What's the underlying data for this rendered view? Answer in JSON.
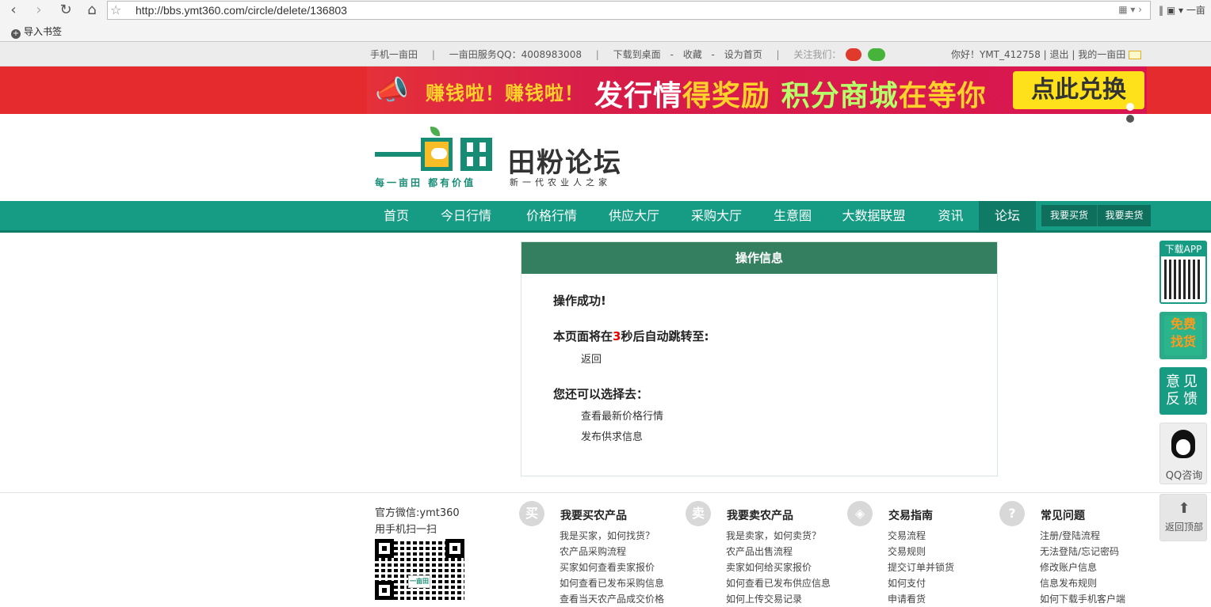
{
  "browser": {
    "back": "‹",
    "forward": "›",
    "reload": "↻",
    "home": "⌂",
    "url": "http://bbs.ymt360.com/circle/delete/136803",
    "bookmark_label": "导入书签",
    "right_fragment": "一亩"
  },
  "topbar": {
    "mobile": "手机一亩田",
    "qq": "一亩田服务QQ：4008983008",
    "download": "下载到桌面",
    "favorite": "收藏",
    "homepage": "设为首页",
    "follow": "关注我们：",
    "greeting": "你好！YMT_412758",
    "logout": "退出",
    "my": "我的一亩田"
  },
  "banner": {
    "earn": "赚钱啦！赚钱啦！",
    "slogan_white1": "发行情",
    "slogan_yellow": "得奖励",
    "slogan_green": "积分商城",
    "slogan_white2": "在等你",
    "cta": "点此兑换"
  },
  "logo": {
    "slogan1": "每一亩田 都有价值",
    "title": "田粉论坛",
    "slogan2": "新一代农业人之家"
  },
  "nav": {
    "items": [
      {
        "label": "首页"
      },
      {
        "label": "今日行情"
      },
      {
        "label": "价格行情"
      },
      {
        "label": "供应大厅"
      },
      {
        "label": "采购大厅"
      },
      {
        "label": "生意圈"
      },
      {
        "label": "大数据联盟"
      },
      {
        "label": "资讯"
      },
      {
        "label": "论坛"
      }
    ],
    "buy": "我要买货",
    "sell": "我要卖货"
  },
  "message": {
    "title": "操作信息",
    "success": "操作成功!",
    "redirect_prefix": "本页面将在",
    "countdown": "3",
    "redirect_suffix": "秒后自动跳转至:",
    "back": "返回",
    "choose": "您还可以选择去：",
    "link1": "查看最新价格行情",
    "link2": "发布供求信息"
  },
  "sidebar": {
    "download_app": "下载APP",
    "free_find_1": "免费",
    "free_find_2": "找货",
    "feedback_1": "意见",
    "feedback_2": "反馈",
    "qq": "QQ咨询",
    "back_top": "返回顶部"
  },
  "footer": {
    "wechat": "官方微信:ymt360",
    "scan": "用手机扫一扫",
    "qr_mark": "一亩田",
    "columns": [
      {
        "icon": "买",
        "title": "我要买农产品",
        "links": [
          "我是买家，如何找货？",
          "农产品采购流程",
          "买家如何查看卖家报价",
          "如何查看已发布采购信息",
          "查看当天农产品成交价格"
        ]
      },
      {
        "icon": "卖",
        "title": "我要卖农产品",
        "links": [
          "我是卖家，如何卖货？",
          "农产品出售流程",
          "卖家如何给买家报价",
          "如何查看已发布供应信息",
          "如何上传交易记录"
        ]
      },
      {
        "icon": "◈",
        "title": "交易指南",
        "links": [
          "交易流程",
          "交易规则",
          "提交订单并锁货",
          "如何支付",
          "申请看货"
        ]
      },
      {
        "icon": "?",
        "title": "常见问题",
        "links": [
          "注册/登陆流程",
          "无法登陆/忘记密码",
          "修改账户信息",
          "信息发布规则",
          "如何下载手机客户端"
        ]
      }
    ]
  }
}
